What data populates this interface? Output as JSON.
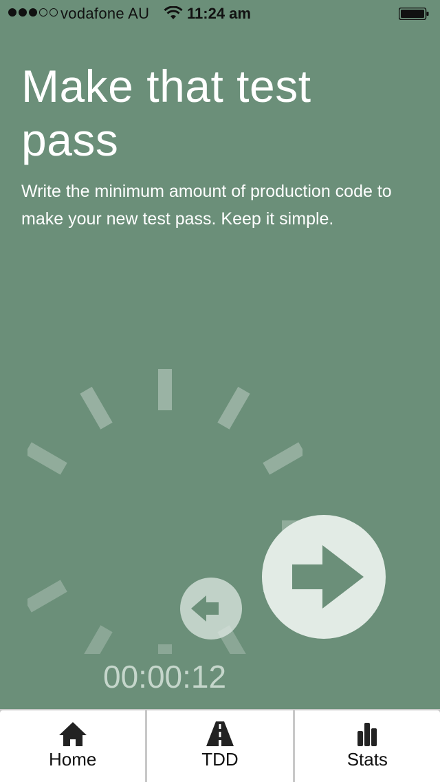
{
  "status_bar": {
    "carrier": "vodafone AU",
    "time": "11:24 am",
    "signal_bars_filled": 3,
    "signal_bars_total": 5
  },
  "screen": {
    "title": "Make that test pass",
    "description": "Write the minimum amount of production code to make your new test pass. Keep it simple.",
    "timer": "00:00:12"
  },
  "buttons": {
    "back_icon": "arrow-left-icon",
    "next_icon": "arrow-right-icon"
  },
  "tabs": [
    {
      "label": "Home",
      "icon": "home-icon"
    },
    {
      "label": "TDD",
      "icon": "road-icon"
    },
    {
      "label": "Stats",
      "icon": "bar-chart-icon"
    }
  ],
  "colors": {
    "background": "#6b8f79",
    "button": "#e2ebe5",
    "timer": "#c5d6cb",
    "tab_background": "#ffffff"
  }
}
